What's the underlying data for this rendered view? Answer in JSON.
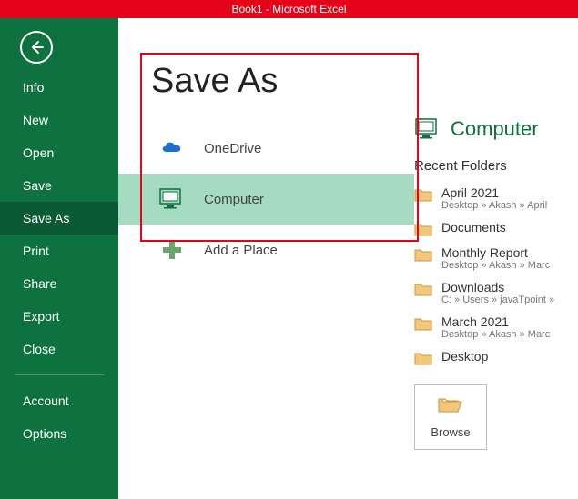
{
  "titlebar": "Book1 -  Microsoft Excel",
  "page_title": "Save As",
  "nav": {
    "items": [
      {
        "label": "Info"
      },
      {
        "label": "New"
      },
      {
        "label": "Open"
      },
      {
        "label": "Save"
      },
      {
        "label": "Save As"
      },
      {
        "label": "Print"
      },
      {
        "label": "Share"
      },
      {
        "label": "Export"
      },
      {
        "label": "Close"
      }
    ],
    "bottom": [
      {
        "label": "Account"
      },
      {
        "label": "Options"
      }
    ],
    "selected_index": 4
  },
  "locations": {
    "items": [
      {
        "label": "OneDrive",
        "icon": "onedrive"
      },
      {
        "label": "Computer",
        "icon": "computer"
      },
      {
        "label": "Add a Place",
        "icon": "plus"
      }
    ],
    "selected_index": 1
  },
  "details": {
    "heading": "Computer",
    "recent_label": "Recent Folders",
    "folders": [
      {
        "name": "April 2021",
        "path": "Desktop » Akash » April"
      },
      {
        "name": "Documents",
        "path": ""
      },
      {
        "name": "Monthly Report",
        "path": "Desktop » Akash » Marc"
      },
      {
        "name": "Downloads",
        "path": "C: » Users » javaTpoint »"
      },
      {
        "name": "March 2021",
        "path": "Desktop » Akash » Marc"
      },
      {
        "name": "Desktop",
        "path": ""
      }
    ],
    "browse_label": "Browse"
  }
}
